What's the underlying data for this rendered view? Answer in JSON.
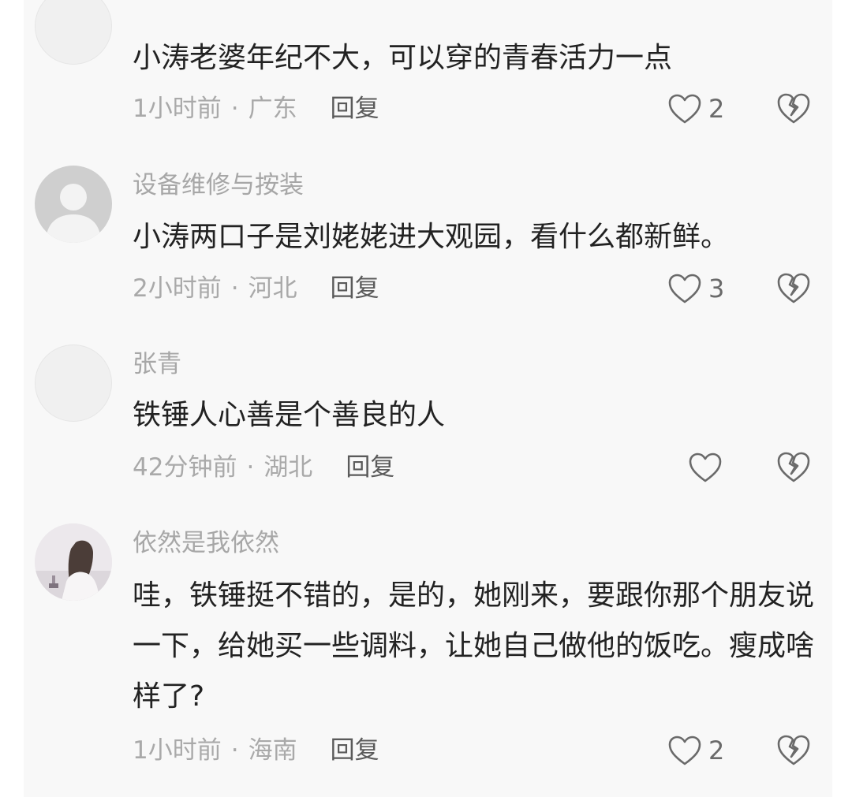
{
  "comments": [
    {
      "avatar": "blank-avatar",
      "username": "",
      "text": "小涛老婆年纪不大，可以穿的青春活力一点",
      "time": "1小时前",
      "location": "广东",
      "reply_label": "回复",
      "likes": "2"
    },
    {
      "avatar": "default-avatar",
      "username": "设备维修与按装",
      "text": "小涛两口子是刘姥姥进大观园，看什么都新鲜。",
      "time": "2小时前",
      "location": "河北",
      "reply_label": "回复",
      "likes": "3"
    },
    {
      "avatar": "blank-avatar",
      "username": "张青",
      "text": "铁锤人心善是个善良的人",
      "time": "42分钟前",
      "location": "湖北",
      "reply_label": "回复",
      "likes": ""
    },
    {
      "avatar": "photo-avatar",
      "username": "依然是我依然",
      "text": "哇，铁锤挺不错的，是的，她刚来，要跟你那个朋友说一下，给她买一些调料，让她自己做他的饭吃。瘦成啥样了?",
      "time": "1小时前",
      "location": "海南",
      "reply_label": "回复",
      "likes": "2"
    }
  ],
  "separator": "·",
  "icons": {
    "like": "heart-outline-icon",
    "dislike": "broken-heart-icon"
  },
  "colors": {
    "text": "#222222",
    "muted": "#a9a9a9",
    "reply": "#5a5a5a",
    "icon": "#6a6a6a"
  }
}
